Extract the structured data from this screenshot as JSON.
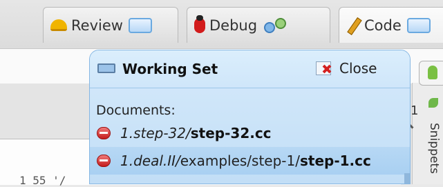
{
  "tabs": [
    {
      "label": "Review",
      "icon": "hard-hat-icon",
      "badge_icon": "screen-icon"
    },
    {
      "label": "Debug",
      "icon": "bug-icon",
      "badge_icon": "network-icon"
    },
    {
      "label": "Code",
      "icon": "pencil-icon",
      "badge_icon": "screen-icon"
    }
  ],
  "working_set": {
    "title": "Working Set",
    "close_label": "Close",
    "documents_heading": "Documents:",
    "documents": [
      {
        "dir": "1.step-32/",
        "path": "",
        "file": "step-32.cc"
      },
      {
        "dir": "1.deal.II/",
        "path": "examples/step-1/",
        "file": "step-1.cc"
      }
    ]
  },
  "side_panel": {
    "number": "1",
    "vertical_label": "Snippets"
  },
  "editor": {
    "line_fragment": "1  55   '/"
  },
  "colors": {
    "popup_bg": "#c2def6",
    "popup_border": "#86b7e3",
    "selected_row": "#a9d0f2",
    "remove_icon": "#c41c1c"
  }
}
